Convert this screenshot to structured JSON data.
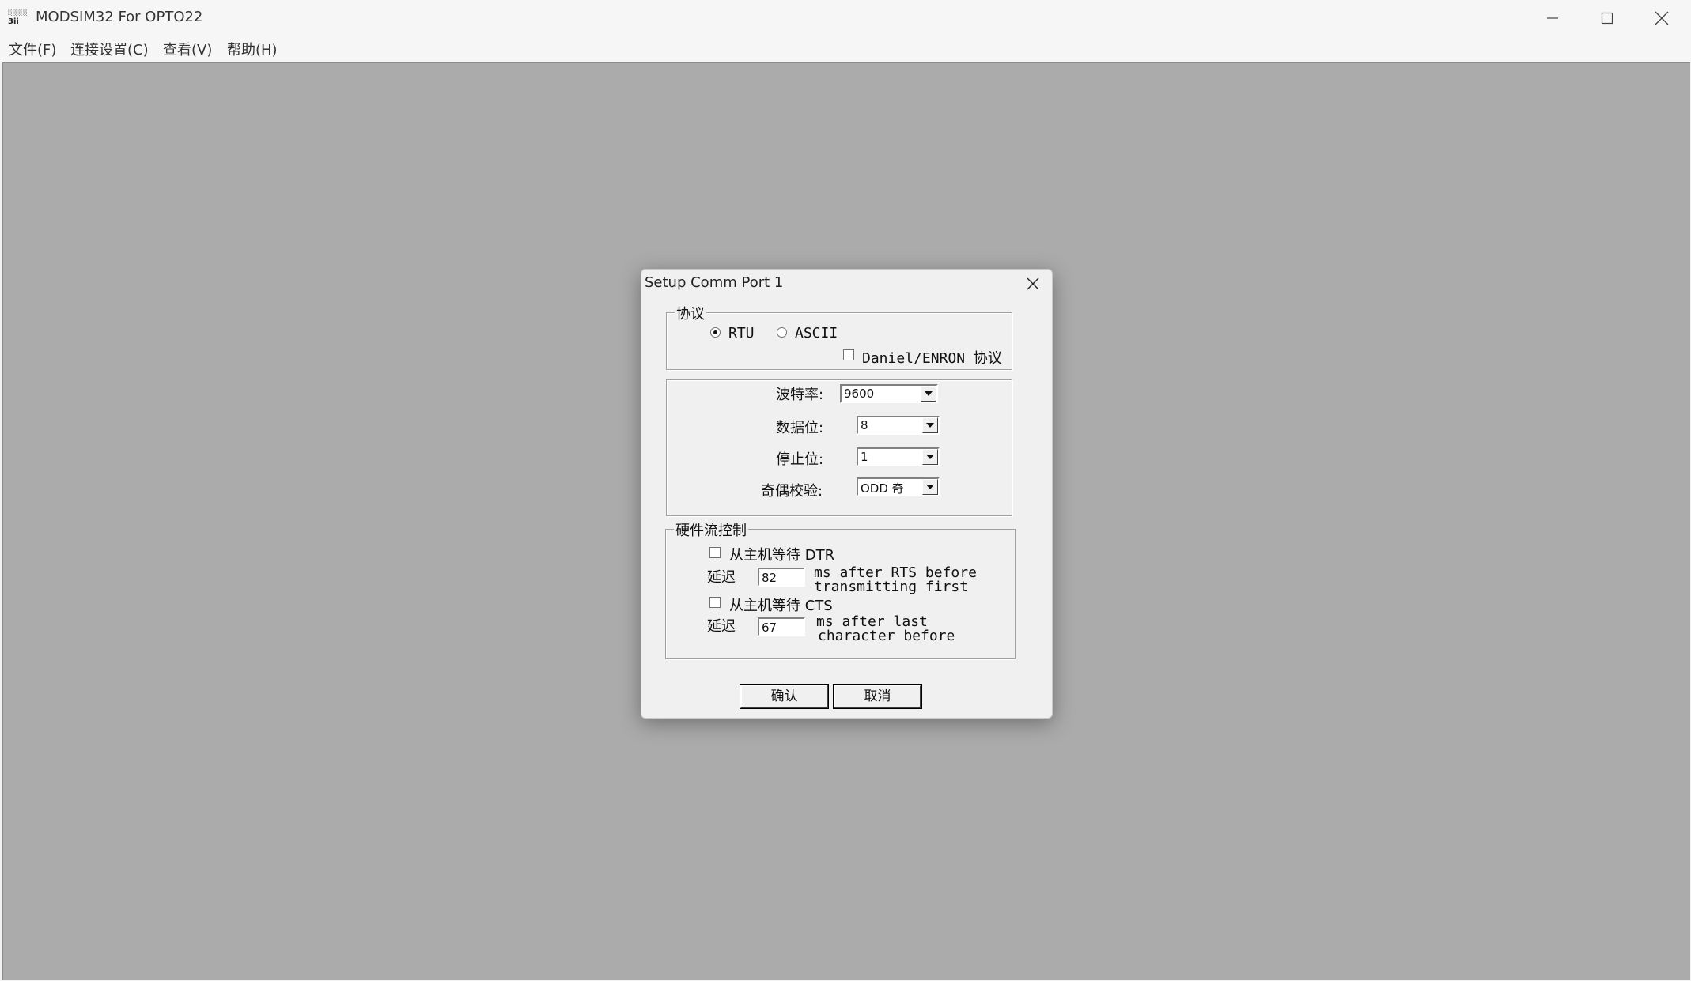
{
  "window": {
    "title": "MODSIM32 For OPTO22",
    "icon_label_top": "░░░░",
    "icon_label": "3ii"
  },
  "window_controls": {
    "minimize": "minimize-icon",
    "maximize": "maximize-icon",
    "close": "close-icon"
  },
  "menu": [
    "文件(F)",
    "连接设置(C)",
    "查看(V)",
    "帮助(H)"
  ],
  "dialog": {
    "title": "Setup Comm Port 1",
    "protocol": {
      "legend": "协议",
      "rtu": "RTU",
      "ascii": "ASCII",
      "selected": "RTU",
      "daniel": "Daniel/ENRON 协议",
      "daniel_checked": false
    },
    "serial": {
      "baud_label": "波特率:",
      "baud_value": "9600",
      "databits_label": "数据位:",
      "databits_value": "8",
      "stopbits_label": "停止位:",
      "stopbits_value": "1",
      "parity_label": "奇偶校验:",
      "parity_value": "ODD 奇"
    },
    "flow": {
      "legend": "硬件流控制",
      "wait_dtr": "从主机等待 DTR",
      "wait_dtr_checked": false,
      "delay1_label": "延迟",
      "delay1_value": "82",
      "delay1_note_line1": "ms after RTS before",
      "delay1_note_line2": "transmitting first",
      "wait_cts": "从主机等待 CTS",
      "wait_cts_checked": false,
      "delay2_label": "延迟",
      "delay2_value": "67",
      "delay2_note_line1": "ms after last",
      "delay2_note_line2": "character before"
    },
    "ok": "确认",
    "cancel": "取消"
  }
}
